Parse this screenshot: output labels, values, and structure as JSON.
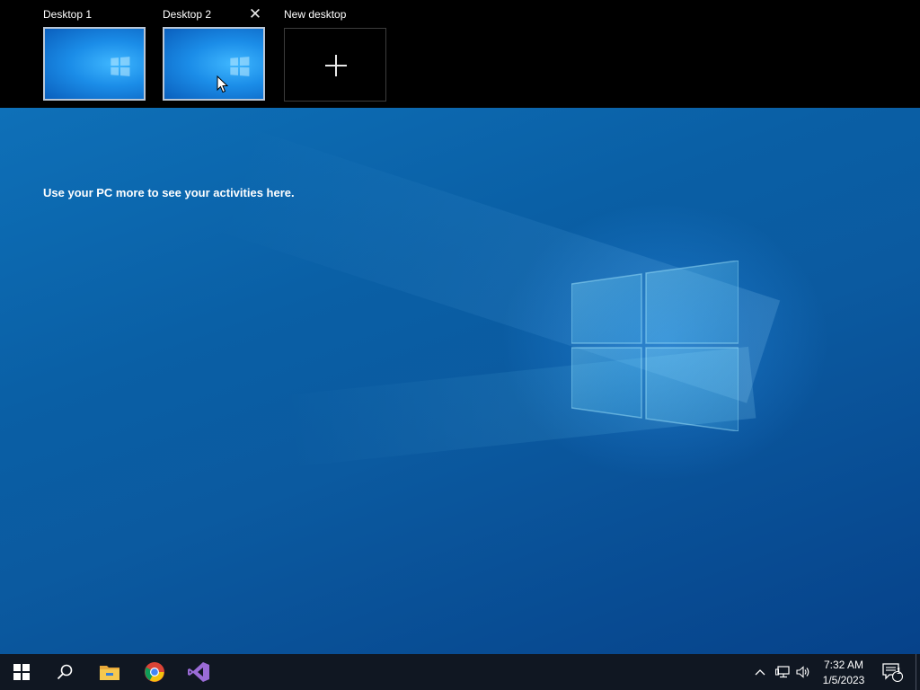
{
  "virtual_desktops": {
    "items": [
      {
        "label": "Desktop 1",
        "active": false
      },
      {
        "label": "Desktop 2",
        "active": true
      }
    ],
    "new_desktop_label": "New desktop",
    "close_icon": "close-icon",
    "plus_icon": "plus-icon"
  },
  "timeline": {
    "message": "Use your PC more to see your activities here."
  },
  "taskbar": {
    "start_icon": "windows-start-icon",
    "search_icon": "search-icon",
    "pinned_apps": [
      "file-explorer-icon",
      "chrome-icon",
      "visual-studio-icon"
    ],
    "tray": {
      "chevron_icon": "chevron-up-icon",
      "network_icon": "network-icon",
      "volume_icon": "volume-icon",
      "time": "7:32 AM",
      "date": "1/5/2023",
      "notification_icon": "action-center-icon",
      "notification_count": "1"
    }
  },
  "colors": {
    "wallpaper_blue": "#0b5aa0",
    "taskbar_bg": "#101722",
    "thumb_border": "#b9c6d6"
  }
}
